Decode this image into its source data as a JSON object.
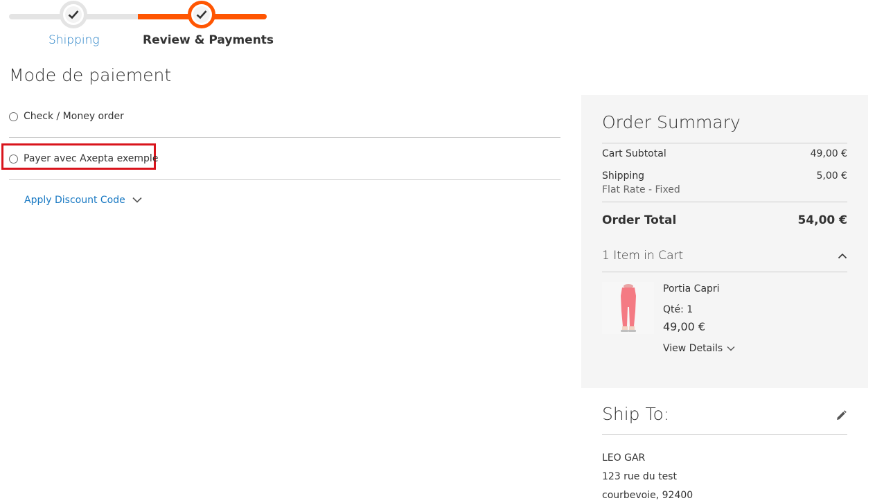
{
  "progress": {
    "steps": [
      {
        "label": "Shipping"
      },
      {
        "label": "Review & Payments"
      }
    ]
  },
  "payment": {
    "title": "Mode de paiement",
    "methods": [
      {
        "label": "Check / Money order"
      },
      {
        "label": "Payer avec Axepta exemple"
      }
    ],
    "discount_label": "Apply Discount Code"
  },
  "summary": {
    "title": "Order Summary",
    "subtotal_label": "Cart Subtotal",
    "subtotal_value": "49,00 €",
    "shipping_label": "Shipping",
    "shipping_value": "5,00 €",
    "shipping_method": "Flat Rate - Fixed",
    "total_label": "Order Total",
    "total_value": "54,00 €",
    "items_label": "1 Item in Cart",
    "item": {
      "name": "Portia Capri",
      "qty": "Qté: 1",
      "price": "49,00 €",
      "details_label": "View Details"
    }
  },
  "ship_to": {
    "title": "Ship To:",
    "name": "LEO GAR",
    "street": "123 rue du test",
    "city": "courbevoie, 92400"
  },
  "colors": {
    "accent": "#ff5501",
    "link": "#1979c3",
    "highlight": "#d9141c"
  }
}
